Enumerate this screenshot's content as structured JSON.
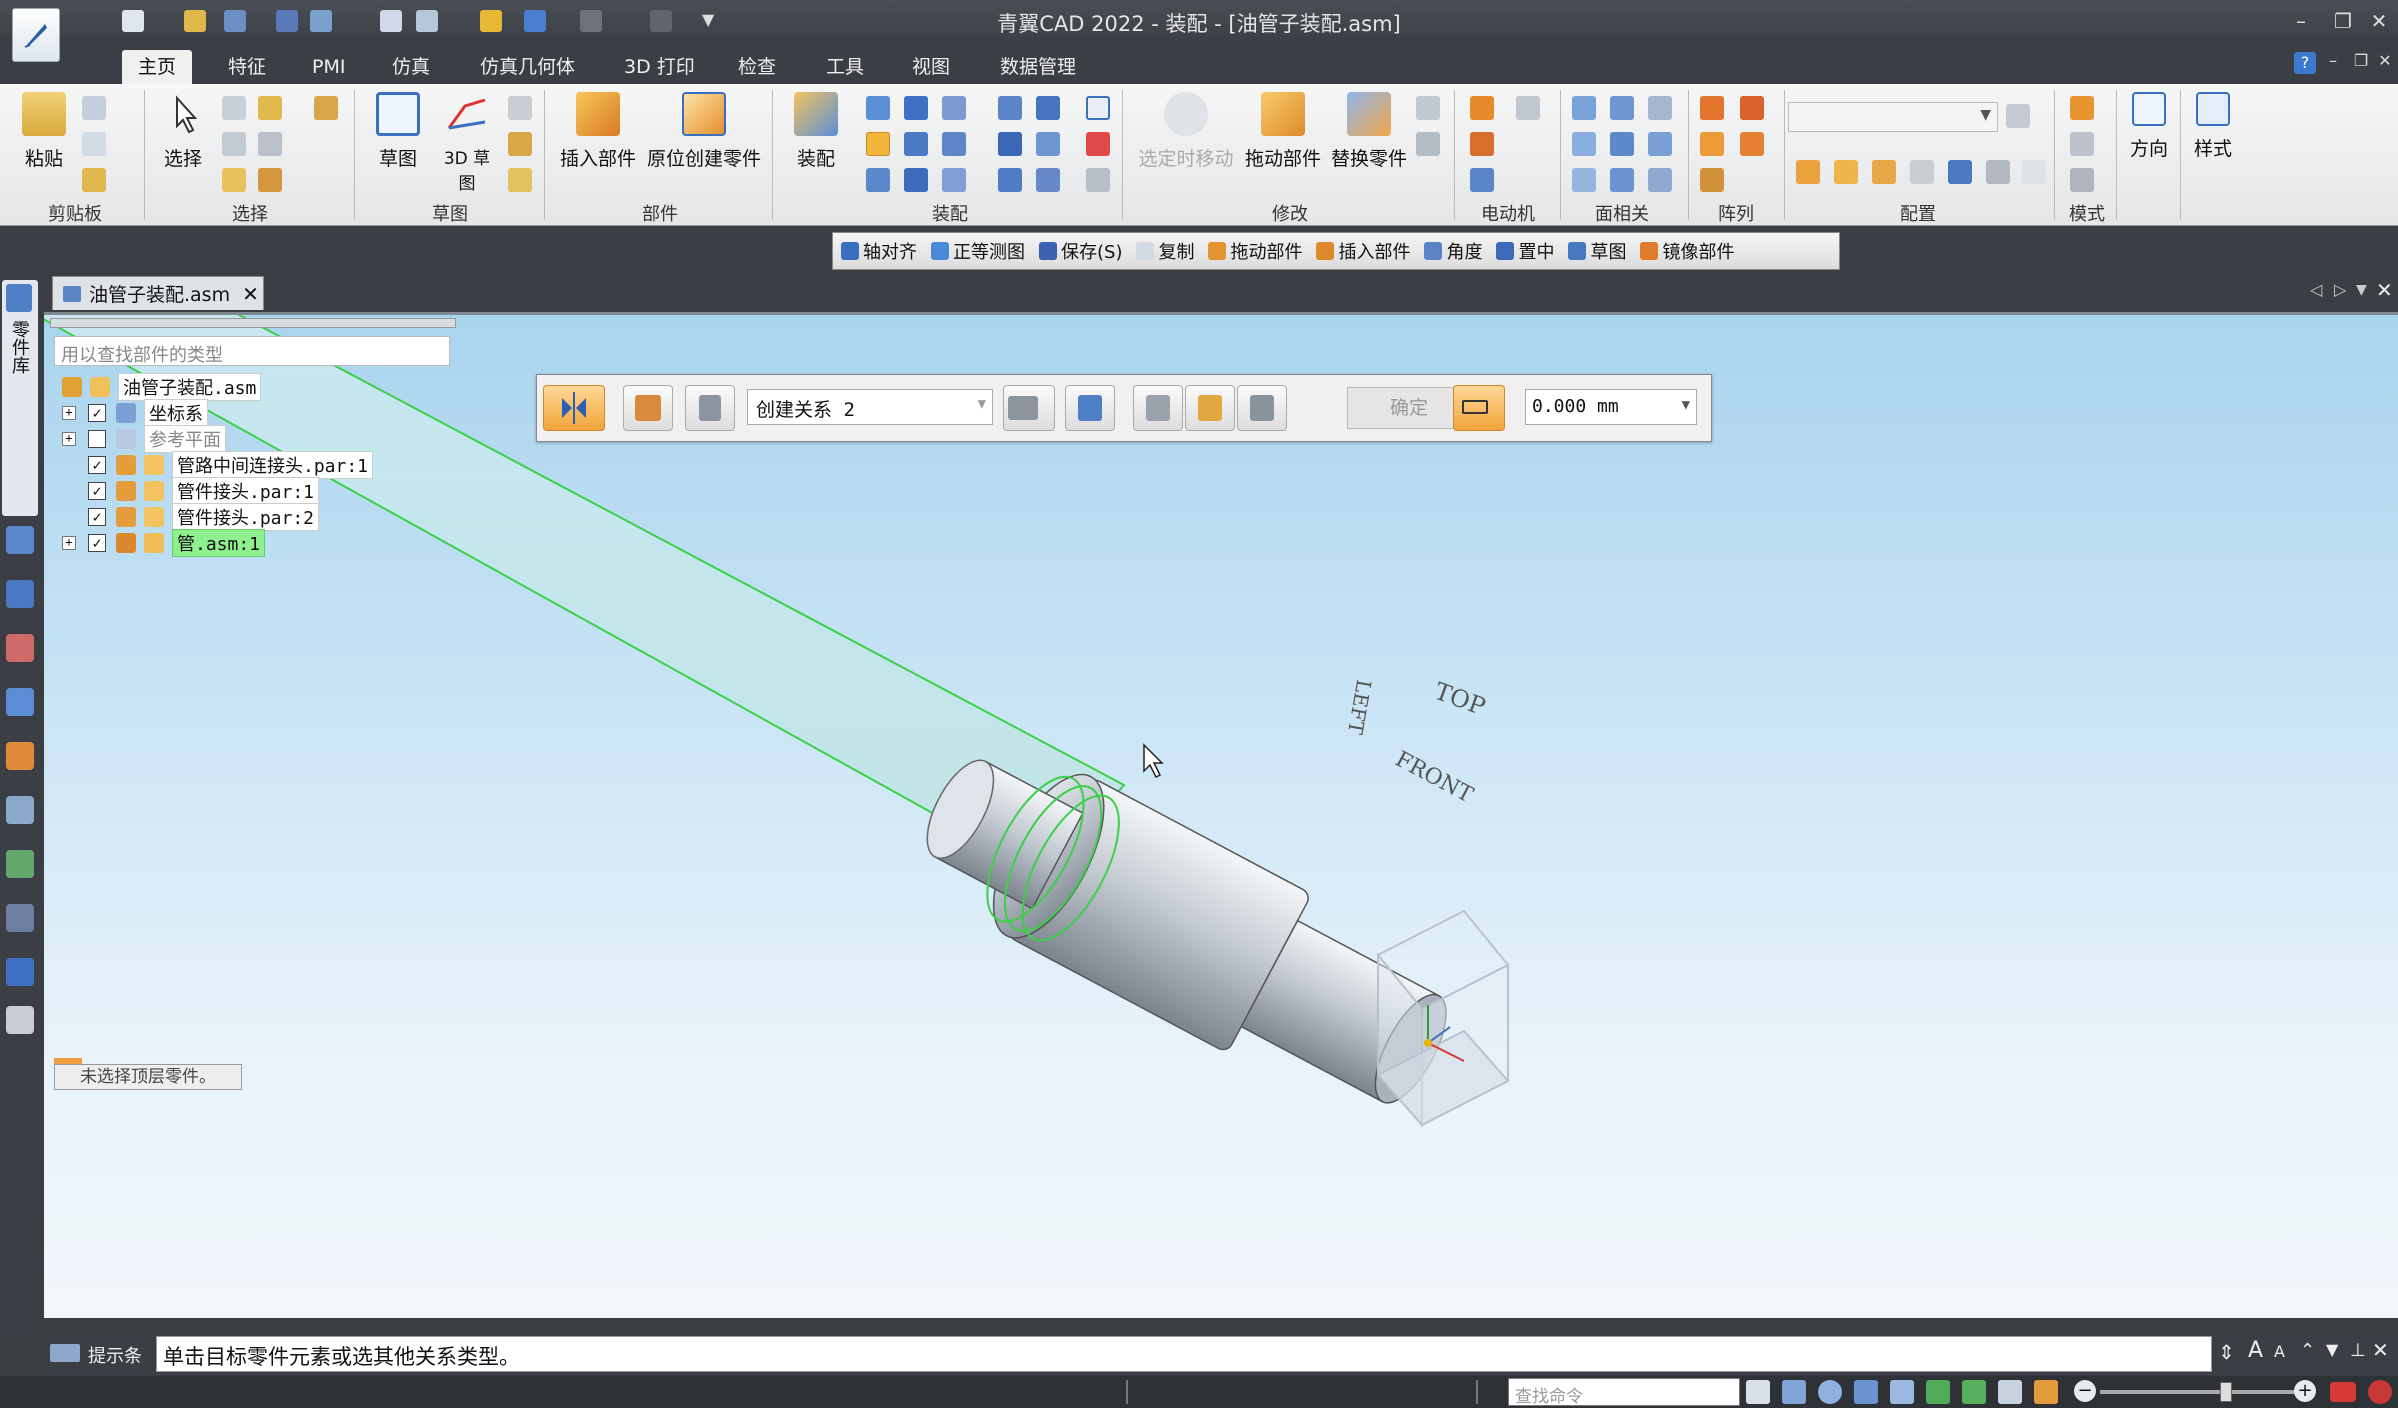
{
  "window": {
    "title": "青翼CAD 2022 - 装配 - [油管子装配.asm]"
  },
  "menu_tabs": [
    "主页",
    "特征",
    "PMI",
    "仿真",
    "仿真几何体",
    "3D 打印",
    "检查",
    "工具",
    "视图",
    "数据管理"
  ],
  "ribbon": {
    "clipboard": {
      "label": "剪贴板",
      "paste": "粘贴"
    },
    "select": {
      "label": "选择",
      "select": "选择"
    },
    "sketch": {
      "label": "草图",
      "sketch": "草图",
      "sketch3d": "3D 草图"
    },
    "parts": {
      "label": "部件",
      "insert": "插入部件",
      "create_in_place": "原位创建零件"
    },
    "assemble": {
      "label": "装配",
      "assemble": "装配"
    },
    "modify": {
      "label": "修改",
      "move_on_select": "选定时移动",
      "drag": "拖动部件",
      "replace": "替换零件"
    },
    "motor": {
      "label": "电动机"
    },
    "face": {
      "label": "面相关"
    },
    "pattern": {
      "label": "阵列"
    },
    "config": {
      "label": "配置"
    },
    "template": {
      "label": "模式"
    },
    "orient": {
      "label": "方向",
      "btn": "方向"
    },
    "style": {
      "label": "样式",
      "btn": "样式"
    }
  },
  "command_bar": [
    "轴对齐",
    "正等测图",
    "保存(S)",
    "复制",
    "拖动部件",
    "插入部件",
    "角度",
    "置中",
    "草图",
    "镜像部件"
  ],
  "document_tab": "油管子装配.asm",
  "library_tab": "零件库",
  "tree": {
    "search_placeholder": "用以查找部件的类型",
    "items": [
      {
        "label": "油管子装配.asm",
        "checked": null
      },
      {
        "label": "坐标系",
        "checked": true
      },
      {
        "label": "参考平面",
        "checked": false
      },
      {
        "label": "管路中间连接头.par:1",
        "checked": true
      },
      {
        "label": "管件接头.par:1",
        "checked": true
      },
      {
        "label": "管件接头.par:2",
        "checked": true
      },
      {
        "label": "管.asm:1",
        "checked": true
      }
    ]
  },
  "assembly_toolbar": {
    "relation": "创建关系 2",
    "confirm": "确定",
    "offset": "0.000 mm"
  },
  "no_top_selected": "未选择顶层零件。",
  "view_cube": {
    "top": "TOP",
    "front": "FRONT",
    "left": "LEFT"
  },
  "prompt": {
    "label": "提示条",
    "text": "单击目标零件元素或选其他关系类型。"
  },
  "status": {
    "find_placeholder": "查找命令"
  }
}
